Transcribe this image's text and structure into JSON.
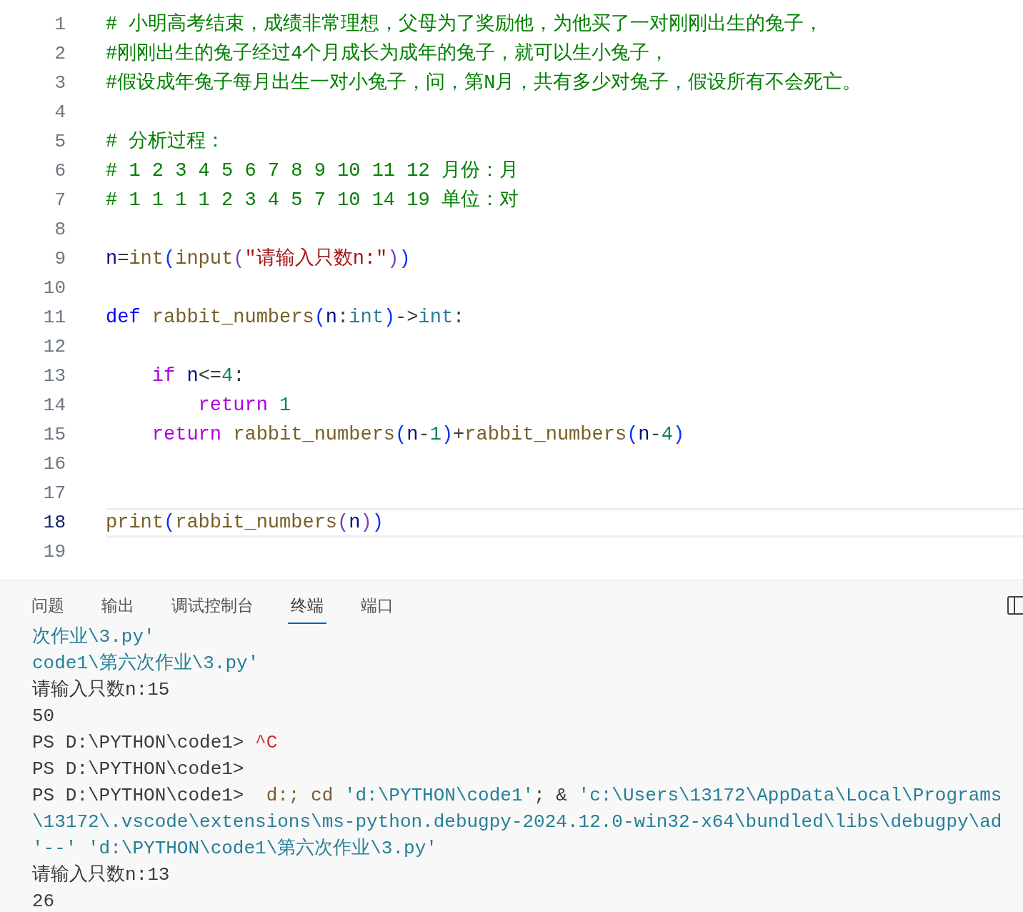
{
  "editor": {
    "lines": [
      {
        "number": "1",
        "selected": false,
        "tokens": [
          {
            "text": "# 小明高考结束，成绩非常理想，父母为了奖励他，为他买了一对刚刚出生的兔子，",
            "kind": "comment"
          }
        ]
      },
      {
        "number": "2",
        "selected": false,
        "tokens": [
          {
            "text": "#刚刚出生的兔子经过4个月成长为成年的兔子，就可以生小兔子，",
            "kind": "comment"
          }
        ]
      },
      {
        "number": "3",
        "selected": false,
        "tokens": [
          {
            "text": "#假设成年兔子每月出生一对小兔子，问，第N月，共有多少对兔子，假设所有不会死亡。",
            "kind": "comment"
          }
        ]
      },
      {
        "number": "4",
        "selected": false
      },
      {
        "number": "5",
        "selected": false,
        "tokens": [
          {
            "text": "# 分析过程：",
            "kind": "comment"
          }
        ]
      },
      {
        "number": "6",
        "selected": false,
        "tokens": [
          {
            "text": "# 1 2 3 4 5 6 7 8 9 10 11 12 月份：月",
            "kind": "comment"
          }
        ]
      },
      {
        "number": "7",
        "selected": false,
        "tokens": [
          {
            "text": "# 1 1 1 1 2 3 4 5 7 10 14 19 单位：对",
            "kind": "comment"
          }
        ]
      },
      {
        "number": "8",
        "selected": false
      },
      {
        "number": "9",
        "selected": false,
        "tokens": [
          {
            "text": "n",
            "kind": "variable"
          },
          {
            "text": "=",
            "kind": "plain"
          },
          {
            "text": "int",
            "kind": "function"
          },
          {
            "text": "(",
            "kind": "bracket1"
          },
          {
            "text": "input",
            "kind": "function"
          },
          {
            "text": "(",
            "kind": "bracket2"
          },
          {
            "text": "\"请输入只数n:\"",
            "kind": "string"
          },
          {
            "text": ")",
            "kind": "bracket2"
          },
          {
            "text": ")",
            "kind": "bracket1"
          }
        ]
      },
      {
        "number": "10",
        "selected": false
      },
      {
        "number": "11",
        "selected": false,
        "tokens": [
          {
            "text": "def",
            "kind": "keyword"
          },
          {
            "text": " rabbit_numbers",
            "kind": "function"
          },
          {
            "text": "(",
            "kind": "bracket1"
          },
          {
            "text": "n",
            "kind": "variable"
          },
          {
            "text": ":",
            "kind": "plain"
          },
          {
            "text": "int",
            "kind": "type"
          },
          {
            "text": ")",
            "kind": "bracket1"
          },
          {
            "text": "->",
            "kind": "plain"
          },
          {
            "text": "int",
            "kind": "type"
          },
          {
            "text": ":",
            "kind": "plain"
          }
        ]
      },
      {
        "number": "12",
        "selected": false
      },
      {
        "number": "13",
        "selected": false,
        "tokens": [
          {
            "text": "    if",
            "kind": "control"
          },
          {
            "text": " n",
            "kind": "variable"
          },
          {
            "text": "<=",
            "kind": "plain"
          },
          {
            "text": "4",
            "kind": "number"
          },
          {
            "text": ":",
            "kind": "plain"
          }
        ]
      },
      {
        "number": "14",
        "selected": false,
        "tokens": [
          {
            "text": "        return",
            "kind": "control"
          },
          {
            "text": " 1",
            "kind": "number"
          }
        ]
      },
      {
        "number": "15",
        "selected": false,
        "tokens": [
          {
            "text": "    return",
            "kind": "control"
          },
          {
            "text": " rabbit_numbers",
            "kind": "function"
          },
          {
            "text": "(",
            "kind": "bracket1"
          },
          {
            "text": "n",
            "kind": "variable"
          },
          {
            "text": "-",
            "kind": "plain"
          },
          {
            "text": "1",
            "kind": "number"
          },
          {
            "text": ")",
            "kind": "bracket1"
          },
          {
            "text": "+",
            "kind": "plain"
          },
          {
            "text": "rabbit_numbers",
            "kind": "function"
          },
          {
            "text": "(",
            "kind": "bracket1"
          },
          {
            "text": "n",
            "kind": "variable"
          },
          {
            "text": "-",
            "kind": "plain"
          },
          {
            "text": "4",
            "kind": "number"
          },
          {
            "text": ")",
            "kind": "bracket1"
          }
        ]
      },
      {
        "number": "16",
        "selected": false
      },
      {
        "number": "17",
        "selected": false
      },
      {
        "number": "18",
        "selected": true,
        "tokens": [
          {
            "text": "print",
            "kind": "function"
          },
          {
            "text": "(",
            "kind": "bracket1"
          },
          {
            "text": "rabbit_numbers",
            "kind": "function"
          },
          {
            "text": "(",
            "kind": "bracket2"
          },
          {
            "text": "n",
            "kind": "variable"
          },
          {
            "text": ")",
            "kind": "bracket2"
          },
          {
            "text": ")",
            "kind": "bracket1"
          }
        ]
      },
      {
        "number": "19",
        "selected": false
      }
    ]
  },
  "panel": {
    "tabs": [
      {
        "label": "问题",
        "selected": false
      },
      {
        "label": "输出",
        "selected": false
      },
      {
        "label": "调试控制台",
        "selected": false
      },
      {
        "label": "终端",
        "selected": true
      },
      {
        "label": "端口",
        "selected": false
      }
    ],
    "terminal_lines": [
      [
        {
          "text": "次作业\\3.py'",
          "kind": "path"
        }
      ],
      [
        {
          "text": "code1\\第六次作业\\3.py'",
          "kind": "path"
        }
      ],
      [
        {
          "text": "请输入只数n:15",
          "kind": "plain"
        }
      ],
      [
        {
          "text": "50",
          "kind": "plain"
        }
      ],
      [
        {
          "text": "PS D:\\PYTHON\\code1> ",
          "kind": "plain"
        },
        {
          "text": "^C",
          "kind": "interrupt"
        }
      ],
      [
        {
          "text": "PS D:\\PYTHON\\code1>",
          "kind": "plain"
        }
      ],
      [
        {
          "text": "PS D:\\PYTHON\\code1>  ",
          "kind": "plain"
        },
        {
          "text": "d:; cd",
          "kind": "command"
        },
        {
          "text": " 'd:\\PYTHON\\code1'",
          "kind": "path"
        },
        {
          "text": "; & ",
          "kind": "plain"
        },
        {
          "text": "'c:\\Users\\13172\\AppData\\Local\\Programs",
          "kind": "path"
        }
      ],
      [
        {
          "text": "\\13172\\.vscode\\extensions\\ms-python.debugpy-2024.12.0-win32-x64\\bundled\\libs\\debugpy\\ad",
          "kind": "path"
        }
      ],
      [
        {
          "text": "'--' 'd:\\PYTHON\\code1\\第六次作业\\3.py'",
          "kind": "path"
        }
      ],
      [
        {
          "text": "请输入只数n:13",
          "kind": "plain"
        }
      ],
      [
        {
          "text": "26",
          "kind": "plain"
        }
      ]
    ]
  }
}
